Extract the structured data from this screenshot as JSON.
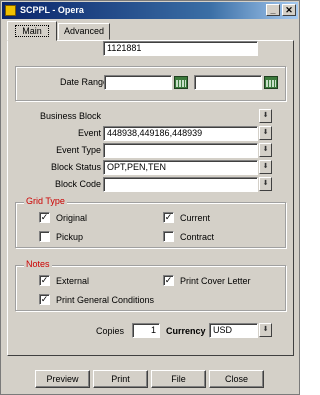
{
  "window": {
    "title": "SCPPL - Opera",
    "minimize_glyph": "_",
    "close_glyph": "✕"
  },
  "tabs": [
    {
      "label": "Main",
      "active": true
    },
    {
      "label": "Advanced",
      "active": false
    }
  ],
  "date_range": {
    "label": "Date Range",
    "from_value": "",
    "to_value": ""
  },
  "fields": {
    "business_block": {
      "label": "Business Block",
      "value": "1121881"
    },
    "event": {
      "label": "Event",
      "value": "448938,449186,448939"
    },
    "event_type": {
      "label": "Event Type",
      "value": ""
    },
    "block_status": {
      "label": "Block Status",
      "value": "OPT,PEN,TEN"
    },
    "block_code": {
      "label": "Block Code",
      "value": ""
    }
  },
  "lov_glyph": "⬇",
  "grid_type": {
    "title": "Grid Type",
    "original": {
      "label": "Original",
      "checked": true
    },
    "current": {
      "label": "Current",
      "checked": true
    },
    "pickup": {
      "label": "Pickup",
      "checked": false
    },
    "contract": {
      "label": "Contract",
      "checked": false
    }
  },
  "notes": {
    "title": "Notes",
    "external": {
      "label": "External",
      "checked": true
    },
    "print_cover_letter": {
      "label": "Print Cover Letter",
      "checked": true
    },
    "print_general_conditions": {
      "label": "Print General Conditions",
      "checked": true
    }
  },
  "check_glyph": "✓",
  "copies": {
    "label": "Copies",
    "value": "1"
  },
  "currency": {
    "label": "Currency",
    "value": "USD"
  },
  "buttons": {
    "preview": "Preview",
    "print": "Print",
    "file": "File",
    "close": "Close"
  }
}
